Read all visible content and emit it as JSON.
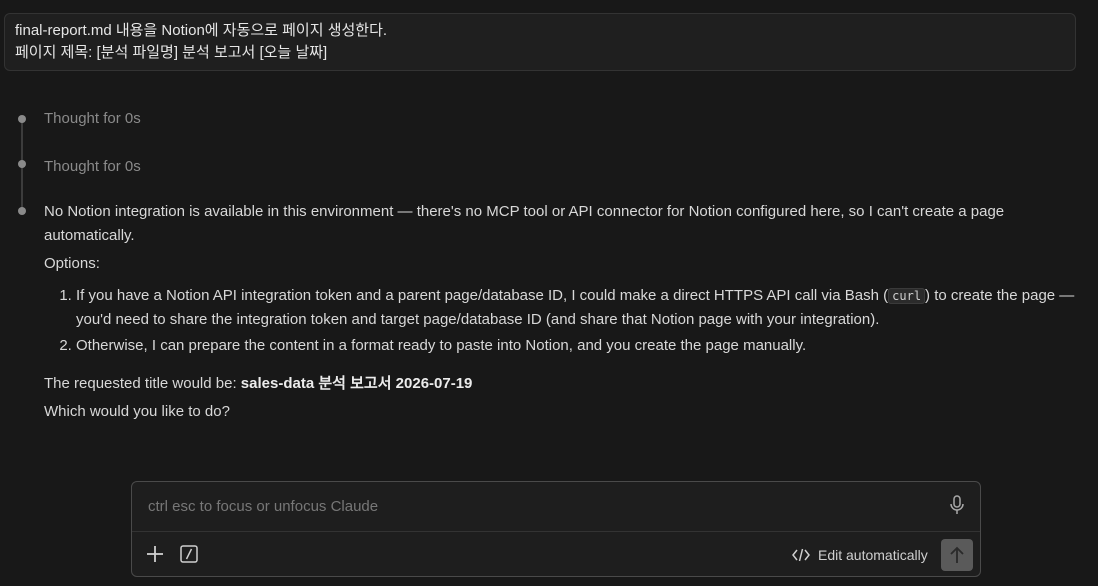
{
  "user_message": {
    "line1": "final-report.md 내용을 Notion에 자동으로 페이지 생성한다.",
    "line2": "페이지 제목: [분석 파일명] 분석 보고서 [오늘 날짜]"
  },
  "thoughts": [
    {
      "label": "Thought for 0s"
    },
    {
      "label": "Thought for 0s"
    }
  ],
  "response": {
    "intro": "No Notion integration is available in this environment — there's no MCP tool or API connector for Notion configured here, so I can't create a page automatically.",
    "options_label": "Options:",
    "option1_before": "If you have a Notion API integration token and a parent page/database ID, I could make a direct HTTPS API call via Bash (",
    "option1_code": "curl",
    "option1_after": ") to create the page — you'd need to share the integration token and target page/database ID (and share that Notion page with your integration).",
    "option2": "Otherwise, I can prepare the content in a format ready to paste into Notion, and you create the page manually.",
    "title_prefix": "The requested title would be: ",
    "title_value": "sales-data 분석 보고서 2026-07-19",
    "question": "Which would you like to do?"
  },
  "composer": {
    "placeholder": "ctrl esc to focus or unfocus Claude",
    "edit_mode_label": "Edit automatically"
  },
  "icons": {
    "mic": "microphone-icon",
    "plus": "plus-icon",
    "slash": "slash-command-icon",
    "code": "code-icon",
    "send": "arrow-up-icon"
  },
  "colors": {
    "background": "#181818",
    "panel": "#1f1f1f",
    "muted_text": "#8a8a8a",
    "send_button": "#5a5a5a"
  }
}
